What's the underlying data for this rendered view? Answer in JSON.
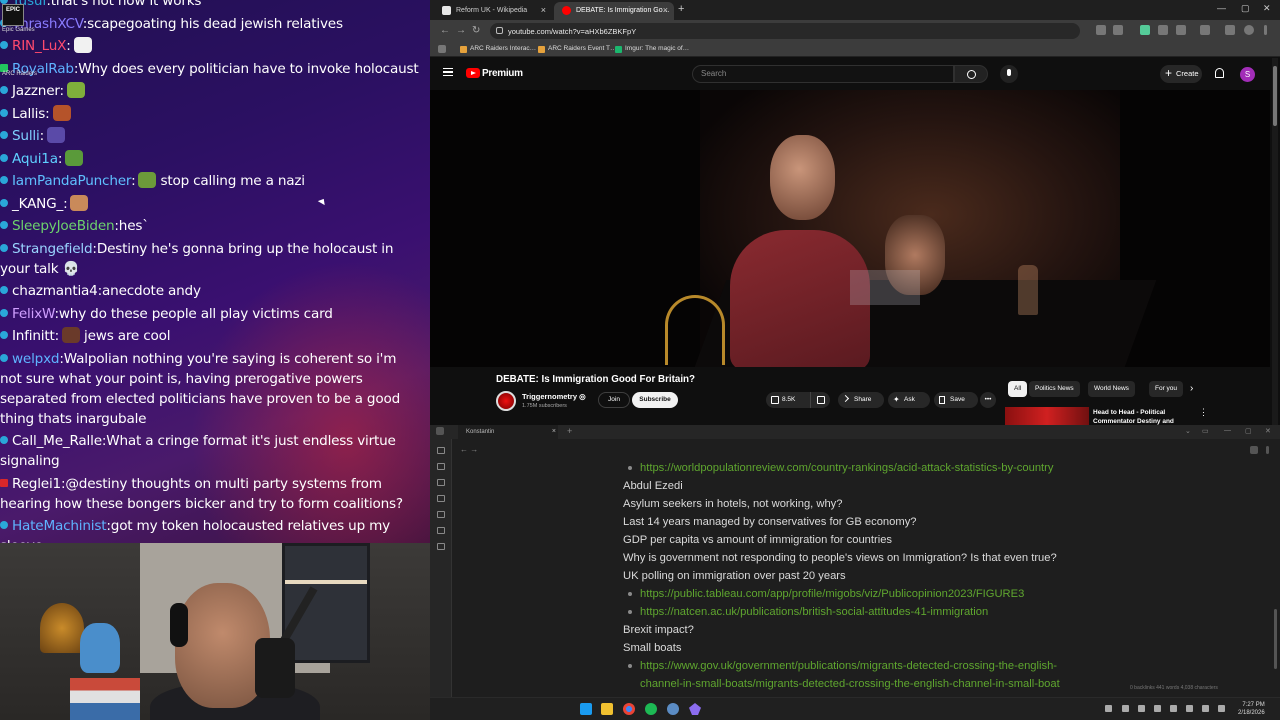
{
  "chat": {
    "overlay_labels": {
      "epic": "EPIC",
      "epic_games": "Epic Games",
      "arc_raiders": "ARC Raiders"
    },
    "messages": [
      {
        "user": "Yusuf",
        "user_color": "#2aa7d9",
        "text": "that's not how it works",
        "badge": "blue"
      },
      {
        "user": "ThrashXCV",
        "user_color": "#8a7cff",
        "text": "scapegoating his dead jewish relatives",
        "badge": "blue"
      },
      {
        "user": "RIN_LuX",
        "user_color": "#ff4a6e",
        "text": "",
        "badge": "blue",
        "emote": "#f1f1f1"
      },
      {
        "user": "RoyalRab",
        "user_color": "#5fb3ff",
        "text": "Why does every politician have to invoke holocaust",
        "badge": "green"
      },
      {
        "user": "Jazzner",
        "user_color": "#ffffff",
        "text": "",
        "badge": "blue",
        "emote": "#7fae3b"
      },
      {
        "user": "Lallis",
        "user_color": "#ffffff",
        "text": "",
        "badge": "blue",
        "emote": "#b5532a"
      },
      {
        "user": "Sulli",
        "user_color": "#7fd0ff",
        "text": "",
        "badge": "blue",
        "emote": "#5a4aa8"
      },
      {
        "user": "Aqui1a",
        "user_color": "#5fd0ff",
        "text": "",
        "badge": "blue",
        "emote": "#5a9a3a"
      },
      {
        "user": "IamPandaPuncher",
        "user_color": "#5fc0ff",
        "text": "stop calling me a nazi",
        "badge": "blue",
        "emote": "#6c9a3a"
      },
      {
        "user": "_KANG_",
        "user_color": "#ffffff",
        "text": "",
        "badge": "blue",
        "emote": "#c98a5a"
      },
      {
        "user": "SleepyJoeBiden",
        "user_color": "#6dd36d",
        "text": "hes`",
        "badge": "blue"
      },
      {
        "user": "Strangefield",
        "user_color": "#9ad4ff",
        "text": "Destiny he's gonna bring up the holocaust in your talk 💀",
        "badge": "blue"
      },
      {
        "user": "chazmantia4",
        "user_color": "#ffffff",
        "text": "anecdote andy",
        "badge": "blue"
      },
      {
        "user": "FelixW",
        "user_color": "#d0a0ff",
        "text": "why do these people all play victims card",
        "badge": "blue"
      },
      {
        "user": "Infinitt",
        "user_color": "#ffffff",
        "text": "jews are cool",
        "badge": "blue",
        "emote": "#6a3a2a"
      },
      {
        "user": "welpxd",
        "user_color": "#5fb3ff",
        "text": "Walpolian nothing you're saying is coherent so i'm not sure what your point is, having prerogative powers separated from elected politicians have proven to be a good thing thats inargubale",
        "badge": "blue"
      },
      {
        "user": "Call_Me_Ralle",
        "user_color": "#ffffff",
        "text": "What a cringe format it's just endless virtue signaling",
        "badge": "blue"
      },
      {
        "user": "Reglei1",
        "user_color": "#ffffff",
        "text": "@destiny thoughts on multi party systems from hearing how these bongers bicker and try to form coalitions?",
        "badge": "red"
      },
      {
        "user": "HateMachinist",
        "user_color": "#5fb3ff",
        "text": "got my token holocausted relatives up my sleeve",
        "badge": "blue"
      }
    ]
  },
  "browser": {
    "tabs": [
      {
        "label": "Reform UK - Wikipedia",
        "active": false
      },
      {
        "label": "DEBATE: Is Immigration Go…",
        "active": true
      }
    ],
    "new_tab": "+",
    "window_controls": {
      "min": "—",
      "max": "▢",
      "close": "✕"
    },
    "url": "youtube.com/watch?v=aHXb6ZBKFpY",
    "bookmarks": [
      "ARC Raiders Interac…",
      "ARC Raiders Event T…",
      "Imgur: The magic of…"
    ],
    "youtube": {
      "brand": "Premium",
      "search_placeholder": "Search",
      "create_label": "Create",
      "avatar_letter": "S",
      "video_title": "DEBATE: Is Immigration Good For Britain?",
      "channel_name": "Triggernometry ◎",
      "channel_subs": "1.75M subscribers",
      "join_label": "Join",
      "subscribe_label": "Subscribe",
      "like_count": "8.5K",
      "share_label": "Share",
      "ask_label": "Ask",
      "save_label": "Save",
      "more_label": "•••",
      "chips": [
        "All",
        "Politics News",
        "World News",
        "For you"
      ],
      "next_chip": "›",
      "rec_title": "Head to Head - Political Commentator Destiny and",
      "rec_more": "⋮"
    }
  },
  "notes": {
    "tab_label": "Konstantin",
    "tab_close": "×",
    "new_tab": "+",
    "nav": "←  →",
    "lines": [
      {
        "type": "link",
        "text": "https://worldpopulationreview.com/country-rankings/acid-attack-statistics-by-country"
      },
      {
        "type": "text",
        "text": "Abdul Ezedi"
      },
      {
        "type": "text",
        "text": "Asylum seekers in hotels, not working, why?"
      },
      {
        "type": "text",
        "text": "Last 14 years managed by conservatives for GB economy?"
      },
      {
        "type": "text",
        "text": "GDP per capita vs amount of immigration for countries"
      },
      {
        "type": "text",
        "text": "Why is government not responding to people's views on Immigration? Is that even true?"
      },
      {
        "type": "text",
        "text": "UK polling on immigration over past 20 years"
      },
      {
        "type": "link",
        "text": "https://public.tableau.com/app/profile/migobs/viz/Publicopinion2023/FIGURE3"
      },
      {
        "type": "link",
        "text": "https://natcen.ac.uk/publications/british-social-attitudes-41-immigration"
      },
      {
        "type": "text",
        "text": "Brexit impact?"
      },
      {
        "type": "text",
        "text": "Small boats"
      },
      {
        "type": "link",
        "text": "https://www.gov.uk/government/publications/migrants-detected-crossing-the-english-"
      },
      {
        "type": "wrap",
        "text": "channel-in-small-boats/migrants-detected-crossing-the-english-channel-in-small-boat"
      }
    ],
    "status": "0 backlinks    441 words  4,038 characters"
  },
  "taskbar": {
    "time": "7:27 PM",
    "date": "2/18/2026"
  }
}
